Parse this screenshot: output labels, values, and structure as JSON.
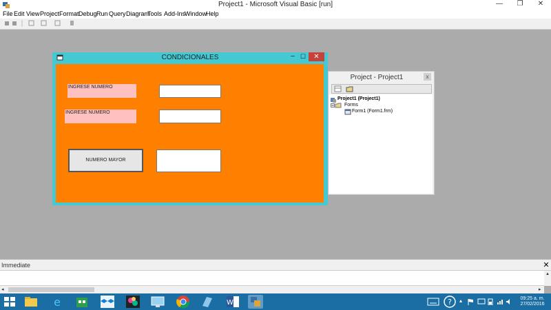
{
  "window": {
    "title": "Project1 - Microsoft Visual Basic [run]",
    "minimize": "—",
    "restore": "❐",
    "close": "✕"
  },
  "menu": [
    "File",
    "Edit",
    "View",
    "Project",
    "Format",
    "Debug",
    "Run",
    "Query",
    "Diagram",
    "Tools",
    "Add-Ins",
    "Window",
    "Help"
  ],
  "form": {
    "title": "CONDICIONALES",
    "label1": "INGRESE NUMERO",
    "label2": "INGRESE NUMERO",
    "button": "NUMERO MAYOR",
    "background_color": "#ff8000",
    "label_color": "#ffc0c0"
  },
  "project_explorer": {
    "title": "Project - Project1",
    "close": "x",
    "tree": {
      "project": "Project1 (Project1)",
      "folder": "Forms",
      "form": "Form1 (Form1.frm)"
    }
  },
  "immediate": {
    "title": "Immediate",
    "close": "✕"
  },
  "taskbar": {
    "time": "09:25 a. m.",
    "date": "27/02/2016",
    "color": "#1a6ea3"
  }
}
